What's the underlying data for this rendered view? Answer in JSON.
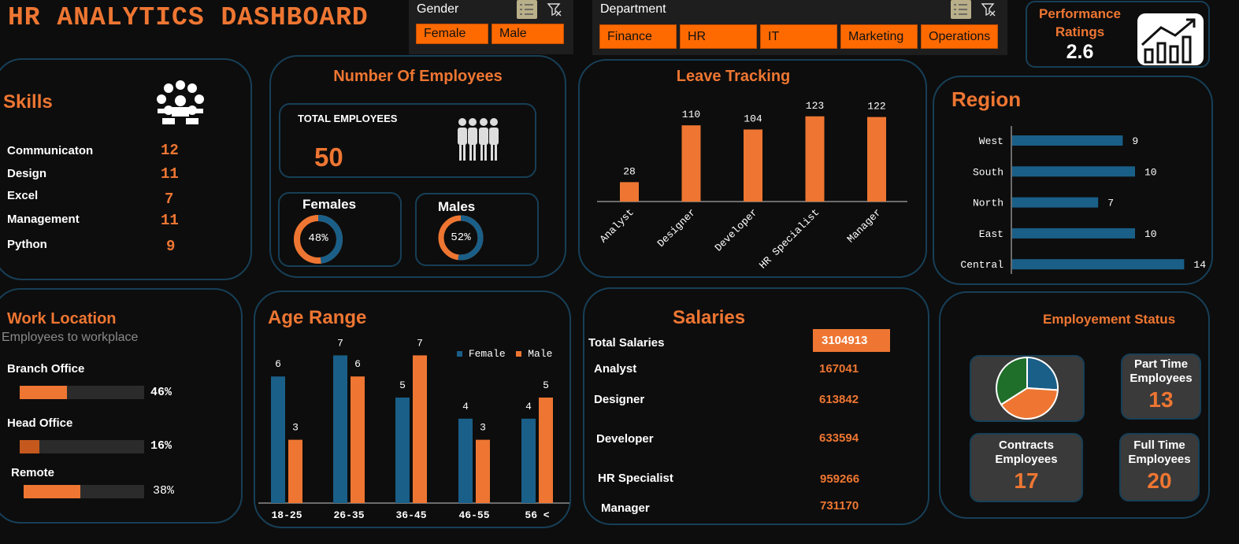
{
  "header": {
    "title": "HR ANALYTICS DASHBOARD"
  },
  "gender_slicer": {
    "label": "Gender",
    "options": [
      "Female",
      "Male"
    ]
  },
  "dept_slicer": {
    "label": "Department",
    "options": [
      "Finance",
      "HR",
      "IT",
      "Marketing",
      "Operations"
    ]
  },
  "performance": {
    "label_line1": "Performance",
    "label_line2": "Ratings",
    "value": "2.6"
  },
  "skills": {
    "title": "Skills",
    "items": [
      {
        "name": "Communicaton",
        "count": "12"
      },
      {
        "name": "Design",
        "count": "11"
      },
      {
        "name": "Excel",
        "count": "7"
      },
      {
        "name": "Management",
        "count": "11"
      },
      {
        "name": "Python",
        "count": "9"
      }
    ]
  },
  "employees": {
    "title": "Number Of Employees",
    "total_label": "TOTAL EMPLOYEES",
    "total": "50",
    "females_label": "Females",
    "females_pct": "48%",
    "females_value": 48,
    "males_label": "Males",
    "males_pct": "52%",
    "males_value": 52
  },
  "leave": {
    "title": "Leave Tracking",
    "chart_data": {
      "type": "bar",
      "categories": [
        "Analyst",
        "Designer",
        "Developer",
        "HR Specialist",
        "Manager"
      ],
      "values": [
        28,
        110,
        104,
        123,
        122
      ]
    }
  },
  "region": {
    "title": "Region",
    "chart_data": {
      "type": "bar",
      "orientation": "horizontal",
      "categories": [
        "West",
        "South",
        "North",
        "East",
        "Central"
      ],
      "values": [
        9,
        10,
        7,
        10,
        14
      ]
    }
  },
  "work_location": {
    "title": "Work Location",
    "subtitle": "Employees to workplace",
    "items": [
      {
        "name": "Branch Office",
        "pct": "46%",
        "value": 46
      },
      {
        "name": "Head Office",
        "pct": "16%",
        "value": 16
      },
      {
        "name": "Remote",
        "pct": "38%",
        "value": 38
      }
    ]
  },
  "age": {
    "title": "Age Range",
    "chart_data": {
      "type": "bar",
      "categories": [
        "18-25",
        "26-35",
        "36-45",
        "46-55",
        "56 <"
      ],
      "series": [
        {
          "name": "Female",
          "values": [
            6,
            7,
            5,
            4,
            4
          ],
          "color": "#1a5f88"
        },
        {
          "name": "Male",
          "values": [
            3,
            6,
            7,
            3,
            5
          ],
          "color": "#ee7632"
        }
      ]
    }
  },
  "salaries": {
    "title": "Salaries",
    "total_label": "Total Salaries",
    "total": "3104913",
    "items": [
      {
        "name": "Analyst",
        "value": "167041"
      },
      {
        "name": "Designer",
        "value": "613842"
      },
      {
        "name": "Developer",
        "value": "633594"
      },
      {
        "name": "HR Specialist",
        "value": "959266"
      },
      {
        "name": "Manager",
        "value": "731170"
      }
    ]
  },
  "status": {
    "title": "Employement Status",
    "part_time_label": "Part Time Employees",
    "part_time": "13",
    "contracts_label": "Contracts Employees",
    "contracts": "17",
    "full_time_label": "Full Time Employees",
    "full_time": "20",
    "chart_data": {
      "type": "pie",
      "slices": [
        {
          "value": 13,
          "color": "#1a5f88"
        },
        {
          "value": 20,
          "color": "#ee7632"
        },
        {
          "value": 17,
          "color": "#1f6e2a"
        }
      ]
    }
  },
  "colors": {
    "accent": "#ee7632",
    "blue": "#1a5f88",
    "border": "#173f57",
    "slicer_btn": "#ff6a00"
  }
}
